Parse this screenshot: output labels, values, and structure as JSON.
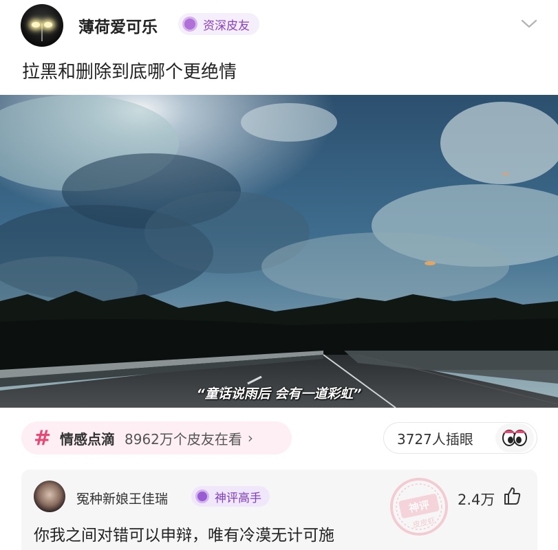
{
  "post": {
    "author": {
      "name": "薄荷爱可乐",
      "badge": "资深皮友",
      "badge_color": "#8a3fc6"
    },
    "title": "拉黑和删除到底哪个更绝情",
    "photo": {
      "caption": "“童话说雨后 会有一道彩虹”",
      "icon": "photo-sky-road"
    }
  },
  "topic": {
    "hash": "#",
    "name": "情感点滴",
    "count_text": "8962万个皮友在看",
    "arrow": "›",
    "accent": "#e94874"
  },
  "poke": {
    "label": "3727人插眼",
    "icon": "eyes-icon"
  },
  "comment": {
    "author": "冤种新娘王佳瑞",
    "badge": "神评高手",
    "stamp_lines": [
      "神评",
      "皮皮虾"
    ],
    "likes": "2.4万",
    "text": "你我之间对错可以申辩，唯有冷漠无计可施"
  }
}
